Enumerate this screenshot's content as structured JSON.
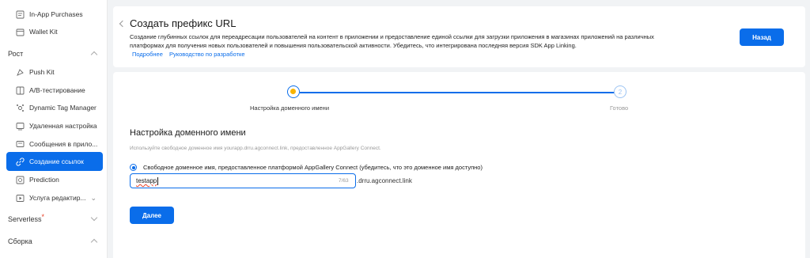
{
  "sidebar": {
    "items_top": [
      {
        "label": "In-App Purchases",
        "icon": "receipt-icon"
      },
      {
        "label": "Wallet Kit",
        "icon": "wallet-icon"
      }
    ],
    "group_growth": "Рост",
    "growth_items": [
      {
        "label": "Push Kit",
        "icon": "push-icon"
      },
      {
        "label": "A/B-тестирование",
        "icon": "ab-test-icon"
      },
      {
        "label": "Dynamic Tag Manager",
        "icon": "tag-manager-icon"
      },
      {
        "label": "Удаленная настройка",
        "icon": "remote-config-icon"
      },
      {
        "label": "Сообщения в прило...",
        "icon": "in-app-message-icon"
      },
      {
        "label": "Создание ссылок",
        "icon": "link-icon"
      },
      {
        "label": "Prediction",
        "icon": "prediction-icon"
      },
      {
        "label": "Услуга редактир...",
        "icon": "video-edit-icon"
      }
    ],
    "group_serverless": "Serverless",
    "serverless_badge": "*",
    "group_build": "Сборка"
  },
  "header": {
    "title": "Создать префикс URL",
    "description": "Создание глубинных ссылок для переадресации пользователей на контент в приложении и предоставление единой ссылки для загрузки приложения в магазинах приложений на различных платформах для получения новых пользователей и повышения пользовательской активности. Убедитесь, что интегрирована последняя версия SDK App Linking.",
    "link_more": "Подробнее",
    "link_guide": "Руководство по разработке",
    "back_button": "Назад"
  },
  "steps": {
    "step1_label": "Настройка доменного имени",
    "step2_number": "2",
    "step2_label": "Готово"
  },
  "form": {
    "section_title": "Настройка доменного имени",
    "hint": "Используйте свободное доменное имя yourapp.drru.agconnect.link, предоставленное AppGallery Connect.",
    "radio_label": "Свободное доменное имя, предоставленное платформой AppGallery Connect (убедитесь, что это доменное имя доступно)",
    "input_value": "testapp",
    "counter": "7/63",
    "suffix": ".drru.agconnect.link",
    "next_button": "Далее"
  },
  "colors": {
    "accent": "#0a6dea",
    "step_current": "#f8b400",
    "badge": "#e84026"
  }
}
